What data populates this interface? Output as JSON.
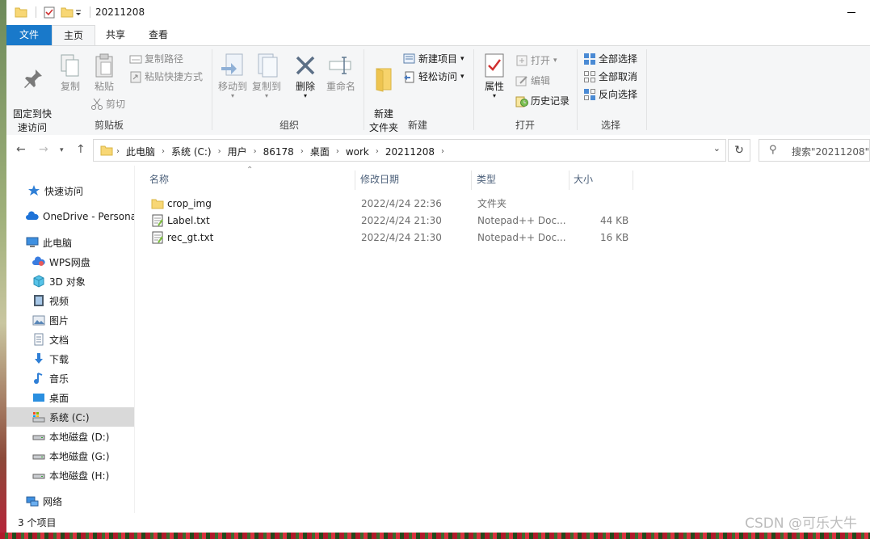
{
  "window": {
    "title": "20211208"
  },
  "ribbon_tabs": [
    "文件",
    "主页",
    "共享",
    "查看"
  ],
  "ribbon": {
    "clipboard": {
      "pin": "固定到快\n速访问",
      "copy": "复制",
      "paste": "粘贴",
      "copy_path": "复制路径",
      "paste_shortcut": "粘贴快捷方式",
      "cut": "剪切",
      "label": "剪贴板"
    },
    "organize": {
      "move_to": "移动到",
      "copy_to": "复制到",
      "delete": "删除",
      "rename": "重命名",
      "label": "组织"
    },
    "new": {
      "new_folder": "新建\n文件夹",
      "new_item": "新建项目",
      "easy_access": "轻松访问",
      "label": "新建"
    },
    "open": {
      "properties": "属性",
      "open": "打开",
      "edit": "编辑",
      "history": "历史记录",
      "label": "打开"
    },
    "select": {
      "select_all": "全部选择",
      "select_none": "全部取消",
      "invert": "反向选择",
      "label": "选择"
    }
  },
  "address": {
    "crumbs": [
      "此电脑",
      "系统 (C:)",
      "用户",
      "86178",
      "桌面",
      "work",
      "20211208"
    ],
    "search_placeholder": "搜索\"20211208\""
  },
  "nav_pane": [
    {
      "label": "快速访问",
      "icon": "star-icon"
    },
    {
      "label": "OneDrive - Personal",
      "icon": "cloud-icon"
    },
    {
      "label": "此电脑",
      "icon": "computer-icon"
    },
    {
      "label": "WPS网盘",
      "icon": "wps-cloud-icon"
    },
    {
      "label": "3D 对象",
      "icon": "cube-icon"
    },
    {
      "label": "视频",
      "icon": "video-icon"
    },
    {
      "label": "图片",
      "icon": "picture-icon"
    },
    {
      "label": "文档",
      "icon": "document-icon"
    },
    {
      "label": "下载",
      "icon": "download-icon"
    },
    {
      "label": "音乐",
      "icon": "music-icon"
    },
    {
      "label": "桌面",
      "icon": "desktop-icon"
    },
    {
      "label": "系统 (C:)",
      "icon": "drive-c-icon"
    },
    {
      "label": "本地磁盘 (D:)",
      "icon": "drive-icon"
    },
    {
      "label": "本地磁盘 (G:)",
      "icon": "drive-icon"
    },
    {
      "label": "本地磁盘 (H:)",
      "icon": "drive-icon"
    },
    {
      "label": "网络",
      "icon": "network-icon"
    }
  ],
  "columns": [
    "名称",
    "修改日期",
    "类型",
    "大小"
  ],
  "files": [
    {
      "name": "crop_img",
      "date": "2022/4/24 22:36",
      "type": "文件夹",
      "size": "",
      "icon": "folder-icon"
    },
    {
      "name": "Label.txt",
      "date": "2022/4/24 21:30",
      "type": "Notepad++ Doc...",
      "size": "44 KB",
      "icon": "notepad-file-icon"
    },
    {
      "name": "rec_gt.txt",
      "date": "2022/4/24 21:30",
      "type": "Notepad++ Doc...",
      "size": "16 KB",
      "icon": "notepad-file-icon"
    }
  ],
  "status": {
    "item_count": "3 个项目"
  },
  "watermark": "CSDN @可乐大牛",
  "colors": {
    "accent": "#1979ca",
    "folder": "#f8d775",
    "selected_nav": "#d9d9d9"
  }
}
